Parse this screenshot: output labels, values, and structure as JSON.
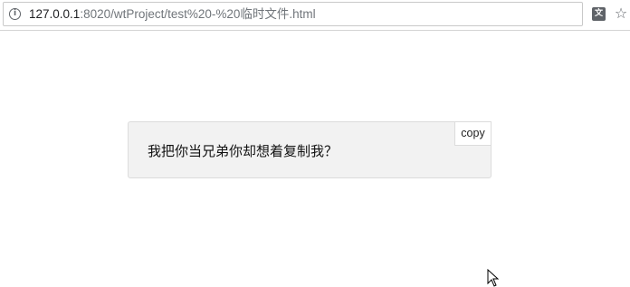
{
  "browser": {
    "url_host": "127.0.0.1",
    "url_rest": ":8020/wtProject/test%20-%20临时文件.html",
    "icons": [
      "info-icon",
      "translate-icon",
      "star-icon"
    ]
  },
  "card": {
    "text": "我把你当兄弟你却想着复制我？",
    "copy_label": "copy"
  },
  "colors": {
    "card_background": "#f2f2f2",
    "card_border": "#dcdcdc",
    "url_host": "#202124",
    "url_path": "#70757a"
  }
}
